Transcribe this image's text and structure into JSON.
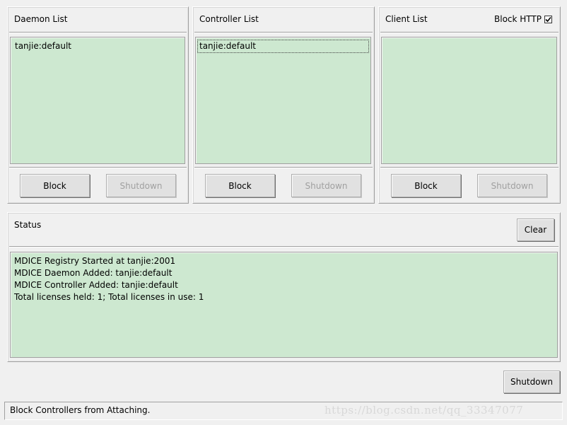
{
  "daemon_panel": {
    "title": "Daemon List",
    "items": [
      "tanjie:default"
    ],
    "block_label": "Block",
    "shutdown_label": "Shutdown"
  },
  "controller_panel": {
    "title": "Controller List",
    "items": [
      "tanjie:default"
    ],
    "block_label": "Block",
    "shutdown_label": "Shutdown"
  },
  "client_panel": {
    "title": "Client List",
    "block_http_label": "Block HTTP",
    "block_http_checked": true,
    "items": [],
    "block_label": "Block",
    "shutdown_label": "Shutdown"
  },
  "status_panel": {
    "title": "Status",
    "clear_label": "Clear",
    "log": [
      "MDICE Registry Started at tanjie:2001",
      "MDICE Daemon Added: tanjie:default",
      "MDICE Controller Added: tanjie:default",
      "Total licenses held: 1; Total licenses in use: 1"
    ]
  },
  "main_shutdown_label": "Shutdown",
  "status_bar_text": "Block Controllers from Attaching.",
  "watermark_text": "https://blog.csdn.net/qq_33347077",
  "colors": {
    "list_background": "#cde8d0",
    "window_background": "#f0f0f0",
    "disabled_text": "#a0a0a0"
  }
}
